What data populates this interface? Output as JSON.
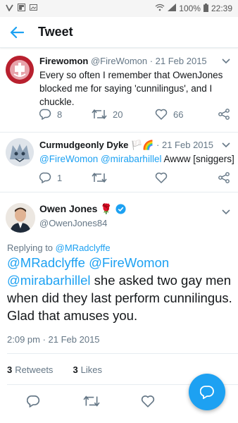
{
  "status_bar": {
    "left_icons": [
      "vine-icon",
      "flipboard-icon",
      "gallery-icon"
    ],
    "battery": "100%",
    "time": "22:39"
  },
  "app_bar": {
    "title": "Tweet"
  },
  "tweets": [
    {
      "name": "Firewomon",
      "handle_date": "@FireWomon · 21 Feb 2015",
      "text": "Every so often I remember that OwenJones blocked me for saying 'cunnilingus', and I chuckle.",
      "reply_count": "",
      "retweet_count": "20",
      "reply_num": "8",
      "like_count": "66"
    },
    {
      "name": "Curmudgeonly Dyke",
      "name_emoji": "🏳️🌈",
      "handle_date": "· 21 Feb 2015",
      "mentions": "@FireWomon @mirabarhillel",
      "text": " Awww [sniggers]",
      "reply_num": "1"
    }
  ],
  "focused": {
    "name": "Owen Jones",
    "emoji": "🌹",
    "handle": "@OwenJones84",
    "replying_prefix": "Replying to ",
    "replying_to": "@MRadclyffe",
    "mentions": "@MRadclyffe @FireWomon @mirabarhillel",
    "text": " she asked two gay men when did they last perform cunnilingus. Glad that amuses you.",
    "timestamp": "2:09 pm · 21 Feb 2015",
    "retweets_num": "3",
    "retweets_label": "Retweets",
    "likes_num": "3",
    "likes_label": "Likes"
  },
  "colors": {
    "accent": "#1da1f2",
    "muted": "#657786",
    "text": "#14171a"
  }
}
